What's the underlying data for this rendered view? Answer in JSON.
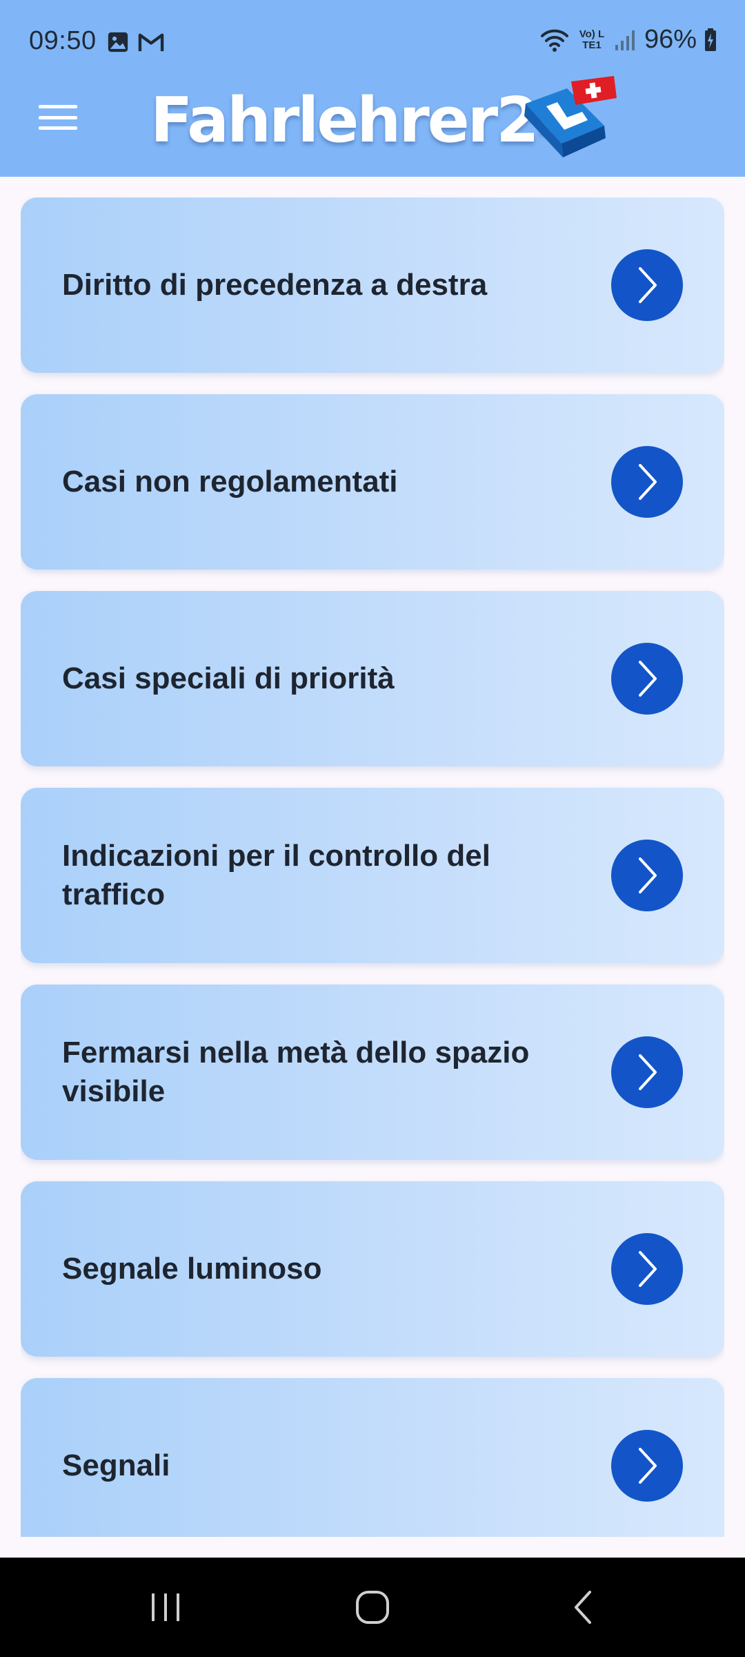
{
  "status_bar": {
    "time": "09:50",
    "battery": "96%",
    "network_label": "Vo) LTE1",
    "left_icons": [
      "image-icon",
      "gmail-icon"
    ],
    "right_icons": [
      "wifi-icon",
      "volte-icon",
      "signal-icon",
      "battery-icon"
    ]
  },
  "header": {
    "title": "Fahrlehrer24",
    "menu_icon": "hamburger-menu-icon",
    "logo": "fahrlehrer24-logo-icon"
  },
  "topics": [
    {
      "label": "Diritto di precedenza a destra"
    },
    {
      "label": "Casi non regolamentati"
    },
    {
      "label": "Casi speciali di priorità"
    },
    {
      "label": "Indicazioni per il controllo del traffico"
    },
    {
      "label": "Fermarsi nella metà dello spazio visibile"
    },
    {
      "label": "Segnale luminoso"
    },
    {
      "label": "Segnali"
    }
  ],
  "card_action_icon": "chevron-right-icon",
  "nav_bar": {
    "buttons": [
      "recent-apps-icon",
      "home-icon",
      "back-icon"
    ]
  },
  "colors": {
    "app_bar": "#80b6f7",
    "accent": "#1355c8",
    "card_start": "#aad0fa",
    "card_end": "#d7e8fd",
    "background": "#fbf7fc",
    "nav_bar": "#000000"
  }
}
